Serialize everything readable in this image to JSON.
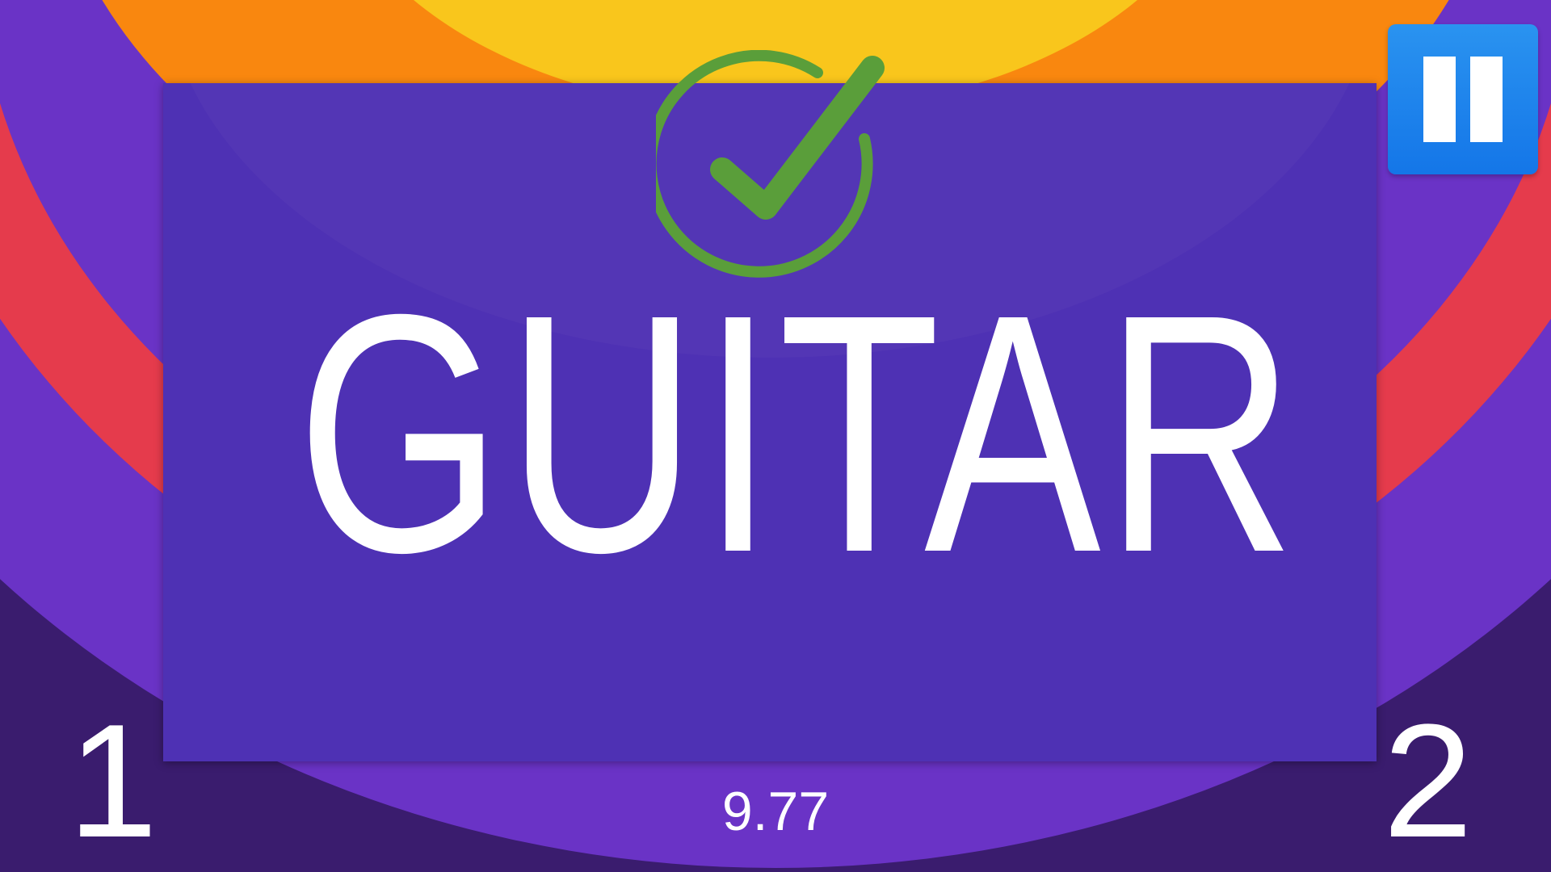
{
  "game": {
    "current_word": "GUITAR",
    "result": "correct",
    "timer": "9.77",
    "team_left_score": "1",
    "team_right_score": "2"
  },
  "controls": {
    "pause_icon": "pause-icon"
  },
  "colors": {
    "background_dark": "#3a1c6e",
    "ring_purple": "#6a33c6",
    "ring_red": "#e53b4c",
    "ring_orange": "#f9870f",
    "ring_yellow": "#f9c61c",
    "card": "#4e31b4",
    "check_green": "#5a9e3a",
    "pause_blue": "#1e86ee"
  }
}
